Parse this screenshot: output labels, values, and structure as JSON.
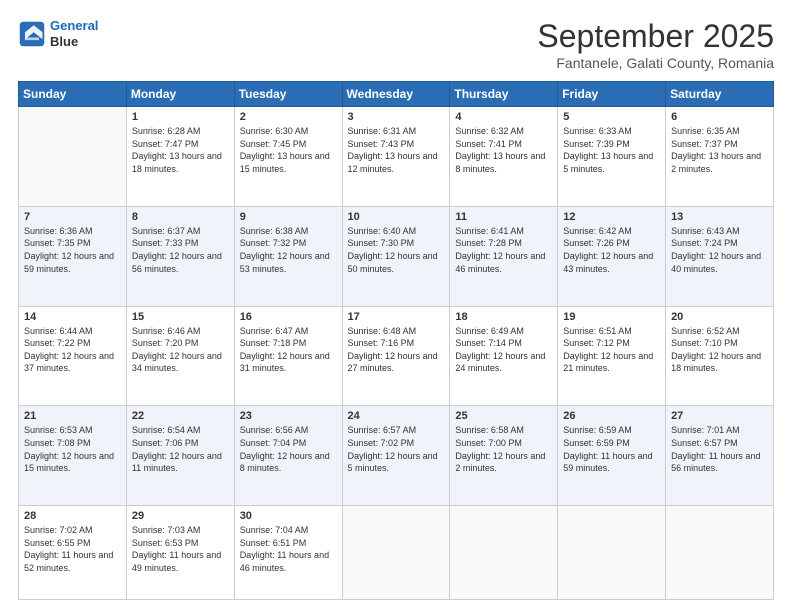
{
  "header": {
    "logo_line1": "General",
    "logo_line2": "Blue",
    "month": "September 2025",
    "location": "Fantanele, Galati County, Romania"
  },
  "days_of_week": [
    "Sunday",
    "Monday",
    "Tuesday",
    "Wednesday",
    "Thursday",
    "Friday",
    "Saturday"
  ],
  "weeks": [
    [
      {
        "day": "",
        "sunrise": "",
        "sunset": "",
        "daylight": ""
      },
      {
        "day": "1",
        "sunrise": "Sunrise: 6:28 AM",
        "sunset": "Sunset: 7:47 PM",
        "daylight": "Daylight: 13 hours and 18 minutes."
      },
      {
        "day": "2",
        "sunrise": "Sunrise: 6:30 AM",
        "sunset": "Sunset: 7:45 PM",
        "daylight": "Daylight: 13 hours and 15 minutes."
      },
      {
        "day": "3",
        "sunrise": "Sunrise: 6:31 AM",
        "sunset": "Sunset: 7:43 PM",
        "daylight": "Daylight: 13 hours and 12 minutes."
      },
      {
        "day": "4",
        "sunrise": "Sunrise: 6:32 AM",
        "sunset": "Sunset: 7:41 PM",
        "daylight": "Daylight: 13 hours and 8 minutes."
      },
      {
        "day": "5",
        "sunrise": "Sunrise: 6:33 AM",
        "sunset": "Sunset: 7:39 PM",
        "daylight": "Daylight: 13 hours and 5 minutes."
      },
      {
        "day": "6",
        "sunrise": "Sunrise: 6:35 AM",
        "sunset": "Sunset: 7:37 PM",
        "daylight": "Daylight: 13 hours and 2 minutes."
      }
    ],
    [
      {
        "day": "7",
        "sunrise": "Sunrise: 6:36 AM",
        "sunset": "Sunset: 7:35 PM",
        "daylight": "Daylight: 12 hours and 59 minutes."
      },
      {
        "day": "8",
        "sunrise": "Sunrise: 6:37 AM",
        "sunset": "Sunset: 7:33 PM",
        "daylight": "Daylight: 12 hours and 56 minutes."
      },
      {
        "day": "9",
        "sunrise": "Sunrise: 6:38 AM",
        "sunset": "Sunset: 7:32 PM",
        "daylight": "Daylight: 12 hours and 53 minutes."
      },
      {
        "day": "10",
        "sunrise": "Sunrise: 6:40 AM",
        "sunset": "Sunset: 7:30 PM",
        "daylight": "Daylight: 12 hours and 50 minutes."
      },
      {
        "day": "11",
        "sunrise": "Sunrise: 6:41 AM",
        "sunset": "Sunset: 7:28 PM",
        "daylight": "Daylight: 12 hours and 46 minutes."
      },
      {
        "day": "12",
        "sunrise": "Sunrise: 6:42 AM",
        "sunset": "Sunset: 7:26 PM",
        "daylight": "Daylight: 12 hours and 43 minutes."
      },
      {
        "day": "13",
        "sunrise": "Sunrise: 6:43 AM",
        "sunset": "Sunset: 7:24 PM",
        "daylight": "Daylight: 12 hours and 40 minutes."
      }
    ],
    [
      {
        "day": "14",
        "sunrise": "Sunrise: 6:44 AM",
        "sunset": "Sunset: 7:22 PM",
        "daylight": "Daylight: 12 hours and 37 minutes."
      },
      {
        "day": "15",
        "sunrise": "Sunrise: 6:46 AM",
        "sunset": "Sunset: 7:20 PM",
        "daylight": "Daylight: 12 hours and 34 minutes."
      },
      {
        "day": "16",
        "sunrise": "Sunrise: 6:47 AM",
        "sunset": "Sunset: 7:18 PM",
        "daylight": "Daylight: 12 hours and 31 minutes."
      },
      {
        "day": "17",
        "sunrise": "Sunrise: 6:48 AM",
        "sunset": "Sunset: 7:16 PM",
        "daylight": "Daylight: 12 hours and 27 minutes."
      },
      {
        "day": "18",
        "sunrise": "Sunrise: 6:49 AM",
        "sunset": "Sunset: 7:14 PM",
        "daylight": "Daylight: 12 hours and 24 minutes."
      },
      {
        "day": "19",
        "sunrise": "Sunrise: 6:51 AM",
        "sunset": "Sunset: 7:12 PM",
        "daylight": "Daylight: 12 hours and 21 minutes."
      },
      {
        "day": "20",
        "sunrise": "Sunrise: 6:52 AM",
        "sunset": "Sunset: 7:10 PM",
        "daylight": "Daylight: 12 hours and 18 minutes."
      }
    ],
    [
      {
        "day": "21",
        "sunrise": "Sunrise: 6:53 AM",
        "sunset": "Sunset: 7:08 PM",
        "daylight": "Daylight: 12 hours and 15 minutes."
      },
      {
        "day": "22",
        "sunrise": "Sunrise: 6:54 AM",
        "sunset": "Sunset: 7:06 PM",
        "daylight": "Daylight: 12 hours and 11 minutes."
      },
      {
        "day": "23",
        "sunrise": "Sunrise: 6:56 AM",
        "sunset": "Sunset: 7:04 PM",
        "daylight": "Daylight: 12 hours and 8 minutes."
      },
      {
        "day": "24",
        "sunrise": "Sunrise: 6:57 AM",
        "sunset": "Sunset: 7:02 PM",
        "daylight": "Daylight: 12 hours and 5 minutes."
      },
      {
        "day": "25",
        "sunrise": "Sunrise: 6:58 AM",
        "sunset": "Sunset: 7:00 PM",
        "daylight": "Daylight: 12 hours and 2 minutes."
      },
      {
        "day": "26",
        "sunrise": "Sunrise: 6:59 AM",
        "sunset": "Sunset: 6:59 PM",
        "daylight": "Daylight: 11 hours and 59 minutes."
      },
      {
        "day": "27",
        "sunrise": "Sunrise: 7:01 AM",
        "sunset": "Sunset: 6:57 PM",
        "daylight": "Daylight: 11 hours and 56 minutes."
      }
    ],
    [
      {
        "day": "28",
        "sunrise": "Sunrise: 7:02 AM",
        "sunset": "Sunset: 6:55 PM",
        "daylight": "Daylight: 11 hours and 52 minutes."
      },
      {
        "day": "29",
        "sunrise": "Sunrise: 7:03 AM",
        "sunset": "Sunset: 6:53 PM",
        "daylight": "Daylight: 11 hours and 49 minutes."
      },
      {
        "day": "30",
        "sunrise": "Sunrise: 7:04 AM",
        "sunset": "Sunset: 6:51 PM",
        "daylight": "Daylight: 11 hours and 46 minutes."
      },
      {
        "day": "",
        "sunrise": "",
        "sunset": "",
        "daylight": ""
      },
      {
        "day": "",
        "sunrise": "",
        "sunset": "",
        "daylight": ""
      },
      {
        "day": "",
        "sunrise": "",
        "sunset": "",
        "daylight": ""
      },
      {
        "day": "",
        "sunrise": "",
        "sunset": "",
        "daylight": ""
      }
    ]
  ]
}
